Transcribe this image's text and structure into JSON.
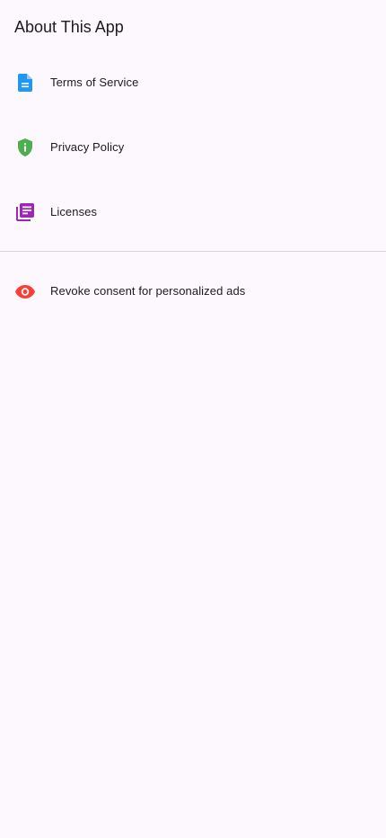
{
  "header": {
    "title": "About This App"
  },
  "list": {
    "items": [
      {
        "label": "Terms of Service",
        "icon": "document-icon",
        "color": "#2196f3"
      },
      {
        "label": "Privacy Policy",
        "icon": "shield-info-icon",
        "color": "#4caf50"
      },
      {
        "label": "Licenses",
        "icon": "library-books-icon",
        "color": "#9c27b0"
      }
    ]
  },
  "consent": {
    "label": "Revoke consent for personalized ads",
    "icon": "eye-icon",
    "color": "#f44336"
  },
  "colors": {
    "background": "#fdf7fe",
    "divider": "#d8d3dc"
  }
}
